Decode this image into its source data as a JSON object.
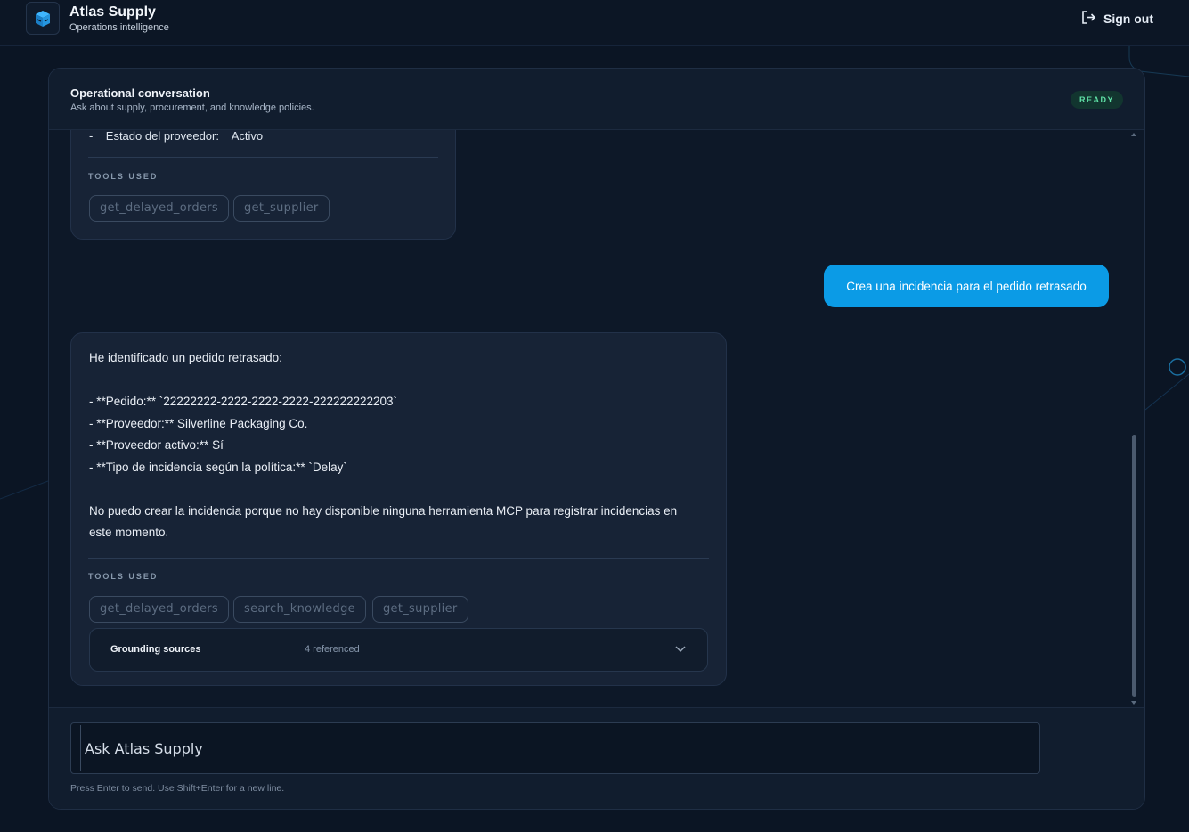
{
  "app": {
    "name": "Atlas Supply",
    "tagline": "Operations intelligence",
    "sign_out_label": "Sign out"
  },
  "conversation": {
    "title": "Operational conversation",
    "subtitle": "Ask about supply, procurement, and knowledge policies.",
    "status_badge": "READY"
  },
  "messages": [
    {
      "role": "assistant",
      "partial_line": "-    Estado del proveedor:    Activo",
      "tools_label": "TOOLS USED",
      "tools": [
        "get_delayed_orders",
        "get_supplier"
      ]
    },
    {
      "role": "user",
      "text": "Crea una incidencia para el pedido retrasado"
    },
    {
      "role": "assistant",
      "lines": [
        "He identificado un pedido retrasado:",
        "- **Pedido:** `22222222-2222-2222-2222-222222222203`",
        "- **Proveedor:** Silverline Packaging Co.",
        "- **Proveedor activo:** Sí",
        "- **Tipo de incidencia según la política:** `Delay`",
        "No puedo crear la incidencia porque no hay disponible ninguna herramienta MCP para registrar incidencias en",
        "este momento."
      ],
      "tools_label": "TOOLS USED",
      "tools": [
        "get_delayed_orders",
        "search_knowledge",
        "get_supplier"
      ],
      "grounding": {
        "title": "Grounding sources",
        "count_text": "4 referenced"
      }
    }
  ],
  "composer": {
    "placeholder": "Ask Atlas Supply",
    "hint": "Press Enter to send. Use Shift+Enter for a new line."
  },
  "colors": {
    "background": "#0b1524",
    "accent": "#0b9be6",
    "ready": "#5fe0a6"
  },
  "icons": [
    "logo-cube-icon",
    "sign-out-icon",
    "chevron-down-icon"
  ]
}
